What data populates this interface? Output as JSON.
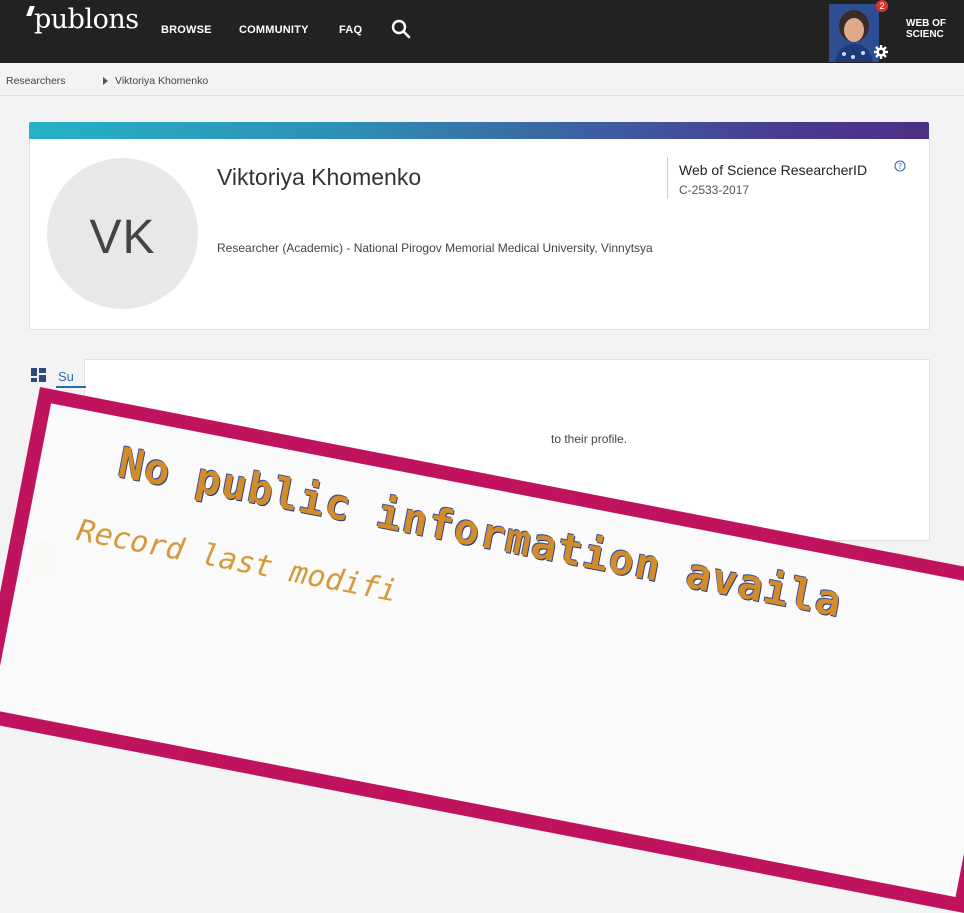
{
  "header": {
    "logo": "publons",
    "nav": [
      "BROWSE",
      "COMMUNITY",
      "FAQ"
    ],
    "notification_count": "2",
    "wos_link": "WEB OF\nSCIENC"
  },
  "breadcrumb": {
    "items": [
      "Researchers",
      "Viktoriya Khomenko"
    ]
  },
  "profile": {
    "initials": "VK",
    "name": "Viktoriya Khomenko",
    "affiliation": "Researcher (Academic) - National Pirogov Memorial Medical University, Vinnytsya",
    "researcher_id_title": "Web of Science ResearcherID",
    "researcher_id": "C-2533-2017"
  },
  "summary": {
    "tab_label": "Su",
    "text_fragment": "to their profile."
  },
  "stamp": {
    "title": "No public information availa",
    "subtitle": "Record last modifi"
  },
  "colors": {
    "accent": "#c0135e",
    "link": "#2a6db5",
    "gradient_start": "#25b1c7",
    "gradient_end": "#4c2f85"
  }
}
